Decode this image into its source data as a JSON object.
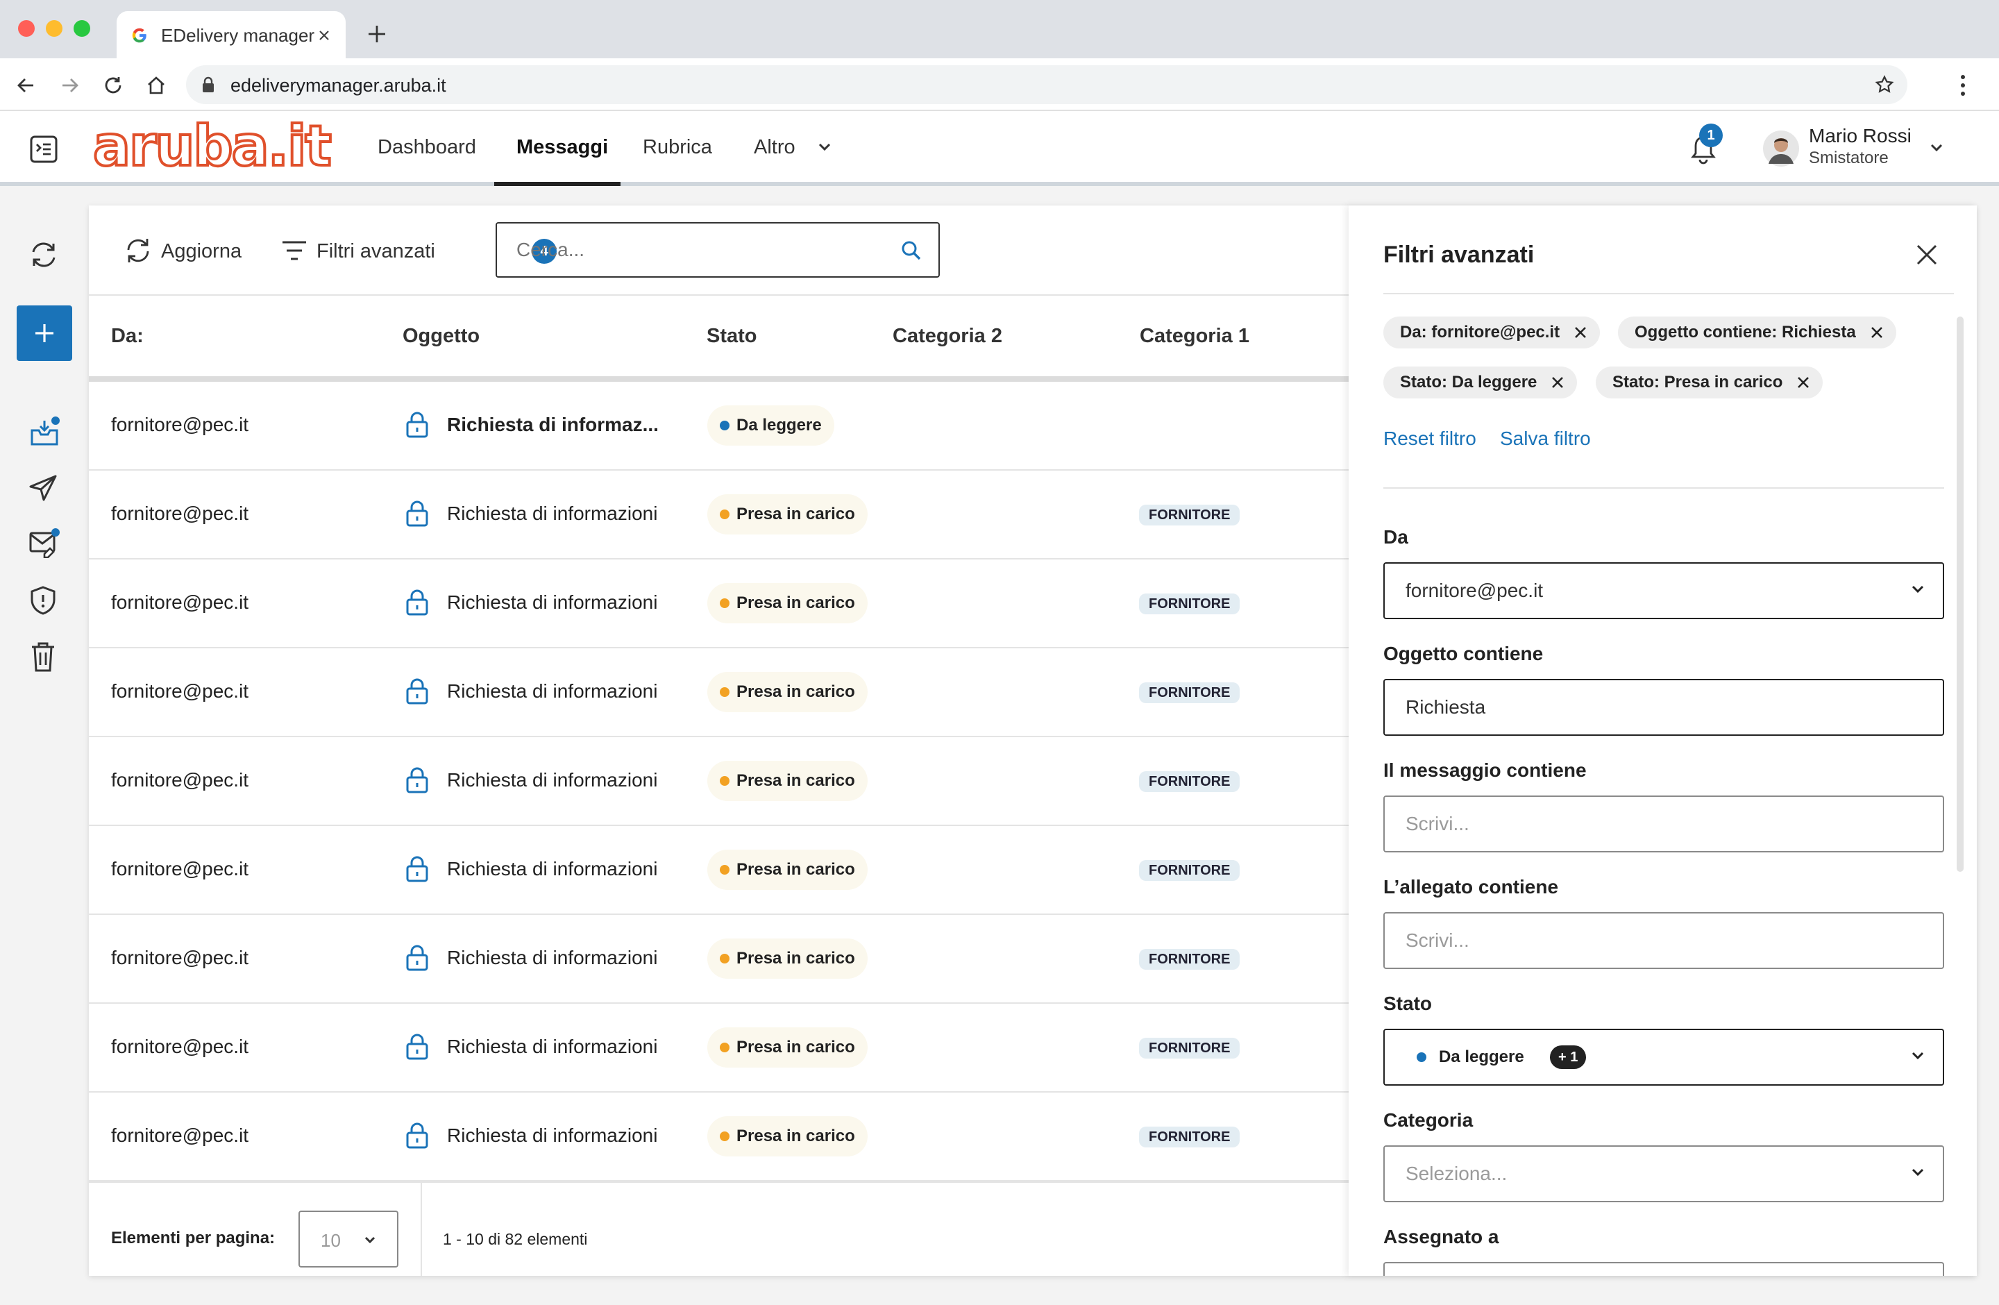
{
  "browser": {
    "tab_title": "EDelivery manager",
    "url": "edeliverymanager.aruba.it"
  },
  "header": {
    "logo": "aruba.it",
    "nav": [
      "Dashboard",
      "Messaggi",
      "Rubrica",
      "Altro"
    ],
    "active_nav": "Messaggi",
    "notification_count": "1",
    "user_name": "Mario Rossi",
    "user_role": "Smistatore"
  },
  "toolbar": {
    "refresh_label": "Aggiorna",
    "filters_label": "Filtri avanzati",
    "filters_count": "4",
    "search_placeholder": "Cerca..."
  },
  "table": {
    "columns": [
      "Da:",
      "Oggetto",
      "Stato",
      "Categoria 2",
      "Categoria 1"
    ],
    "rows": [
      {
        "from": "fornitore@pec.it",
        "subject": "Richiesta di informaz...",
        "status": "Da leggere",
        "status_color": "#1a73b8",
        "cat2": "",
        "cat1": "",
        "bold": true
      },
      {
        "from": "fornitore@pec.it",
        "subject": "Richiesta di informazioni",
        "status": "Presa in carico",
        "status_color": "#f2a122",
        "cat2": "",
        "cat1": "FORNITORE",
        "bold": false
      },
      {
        "from": "fornitore@pec.it",
        "subject": "Richiesta di informazioni",
        "status": "Presa in carico",
        "status_color": "#f2a122",
        "cat2": "",
        "cat1": "FORNITORE",
        "bold": false
      },
      {
        "from": "fornitore@pec.it",
        "subject": "Richiesta di informazioni",
        "status": "Presa in carico",
        "status_color": "#f2a122",
        "cat2": "",
        "cat1": "FORNITORE",
        "bold": false
      },
      {
        "from": "fornitore@pec.it",
        "subject": "Richiesta di informazioni",
        "status": "Presa in carico",
        "status_color": "#f2a122",
        "cat2": "",
        "cat1": "FORNITORE",
        "bold": false
      },
      {
        "from": "fornitore@pec.it",
        "subject": "Richiesta di informazioni",
        "status": "Presa in carico",
        "status_color": "#f2a122",
        "cat2": "",
        "cat1": "FORNITORE",
        "bold": false
      },
      {
        "from": "fornitore@pec.it",
        "subject": "Richiesta di informazioni",
        "status": "Presa in carico",
        "status_color": "#f2a122",
        "cat2": "",
        "cat1": "FORNITORE",
        "bold": false
      },
      {
        "from": "fornitore@pec.it",
        "subject": "Richiesta di informazioni",
        "status": "Presa in carico",
        "status_color": "#f2a122",
        "cat2": "",
        "cat1": "FORNITORE",
        "bold": false
      },
      {
        "from": "fornitore@pec.it",
        "subject": "Richiesta di informazioni",
        "status": "Presa in carico",
        "status_color": "#f2a122",
        "cat2": "",
        "cat1": "FORNITORE",
        "bold": false
      }
    ]
  },
  "pagination": {
    "per_page_label": "Elementi per pagina:",
    "per_page_value": "10",
    "range_text": "1 - 10 di 82 elementi"
  },
  "filters_panel": {
    "title": "Filtri avanzati",
    "chips": [
      "Da: fornitore@pec.it",
      "Oggetto contiene: Richiesta",
      "Stato: Da leggere",
      "Stato: Presa in carico"
    ],
    "reset_label": "Reset filtro",
    "save_label": "Salva filtro",
    "from_label": "Da",
    "from_value": "fornitore@pec.it",
    "subject_label": "Oggetto contiene",
    "subject_value": "Richiesta",
    "message_label": "Il messaggio contiene",
    "message_placeholder": "Scrivi...",
    "attachment_label": "L’allegato contiene",
    "attachment_placeholder": "Scrivi...",
    "state_label": "Stato",
    "state_value": "Da leggere",
    "state_extra": "+ 1",
    "category_label": "Categoria",
    "category_placeholder": "Seleziona...",
    "assigned_label": "Assegnato a"
  },
  "colors": {
    "accent": "#1a73b8",
    "brand": "#e0502b",
    "read": "#1a73b8",
    "in_progress": "#f2a122"
  }
}
